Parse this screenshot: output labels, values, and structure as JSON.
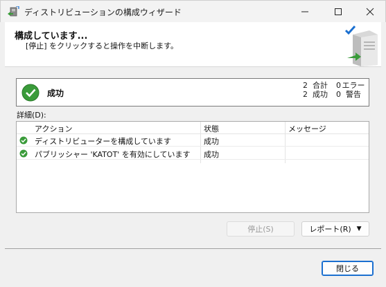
{
  "window": {
    "title": "ディストリビューションの構成ウィザード",
    "minimize_icon": "minimize-icon",
    "maximize_icon": "maximize-icon",
    "close_icon": "close-icon"
  },
  "header": {
    "title": "構成しています...",
    "subtitle": "[停止] をクリックすると操作を中断します。"
  },
  "status": {
    "label": "成功",
    "counts": [
      {
        "value": "2",
        "label": "合計",
        "value2": "0",
        "label2": "エラー"
      },
      {
        "value": "2",
        "label": "成功",
        "value2": "0",
        "label2": "警告"
      }
    ]
  },
  "details": {
    "label": "詳細(D):",
    "columns": [
      "アクション",
      "状態",
      "メッセージ"
    ],
    "rows": [
      {
        "action": "ディストリビューターを構成しています",
        "status": "成功",
        "message": ""
      },
      {
        "action": "パブリッシャー 'KATOT' を有効にしています",
        "status": "成功",
        "message": ""
      }
    ]
  },
  "buttons": {
    "stop": "停止(S)",
    "report": "レポート(R)",
    "close": "閉じる"
  },
  "colors": {
    "success_green": "#3a9b3a",
    "accent_blue": "#1a6fd0"
  }
}
